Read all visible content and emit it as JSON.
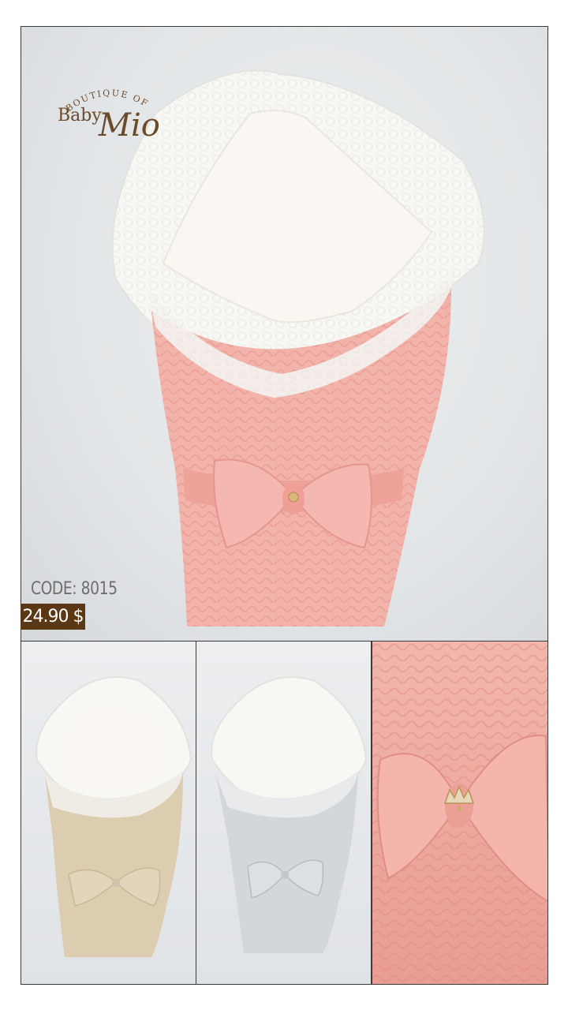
{
  "logo": {
    "arc_text": "BOUTIQUE OF",
    "word1": "Baby",
    "word2": "Mio",
    "color": "#6b4a2a"
  },
  "product": {
    "code": "CODE: 8015",
    "price": "24.90 $"
  },
  "colors": {
    "pink": "#f2b3ab",
    "beige": "#dcccb0",
    "grey": "#d3d6da",
    "price_bg": "#5a3715"
  },
  "variants": [
    {
      "color_name": "beige"
    },
    {
      "color_name": "grey"
    },
    {
      "color_name": "pink-closeup"
    }
  ]
}
